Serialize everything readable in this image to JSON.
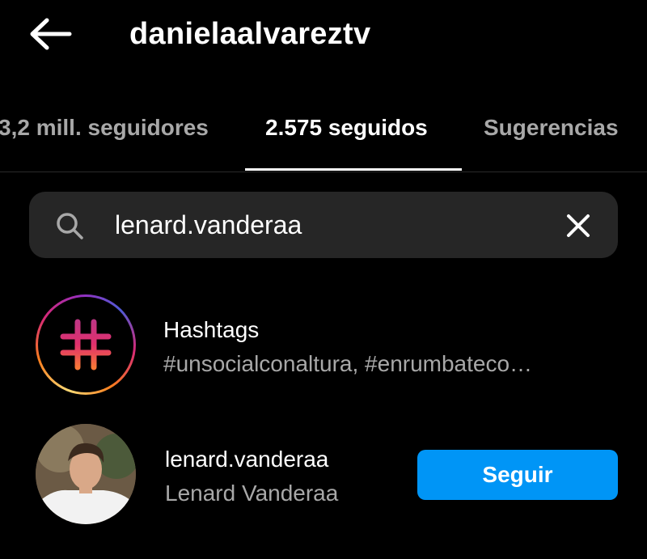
{
  "header": {
    "back_icon": "arrow-left-icon",
    "title": "danielaalvareztv"
  },
  "tabs": [
    {
      "label": "3,2 mill. seguidores",
      "active": false
    },
    {
      "label": "2.575 seguidos",
      "active": true
    },
    {
      "label": "Sugerencias",
      "active": false
    }
  ],
  "search": {
    "icon": "search-icon",
    "value": "lenard.vanderaa",
    "clear_icon": "close-icon"
  },
  "results": {
    "hashtags": {
      "icon": "hashtag-icon",
      "title": "Hashtags",
      "subtitle": "#unsocialconaltura, #enrumbateco…"
    },
    "user": {
      "username": "lenard.vanderaa",
      "full_name": "Lenard Vanderaa",
      "follow_label": "Seguir"
    }
  },
  "colors": {
    "background": "#000000",
    "search_bg": "#262626",
    "secondary_text": "#a8a8a8",
    "follow_button": "#0095f6"
  }
}
